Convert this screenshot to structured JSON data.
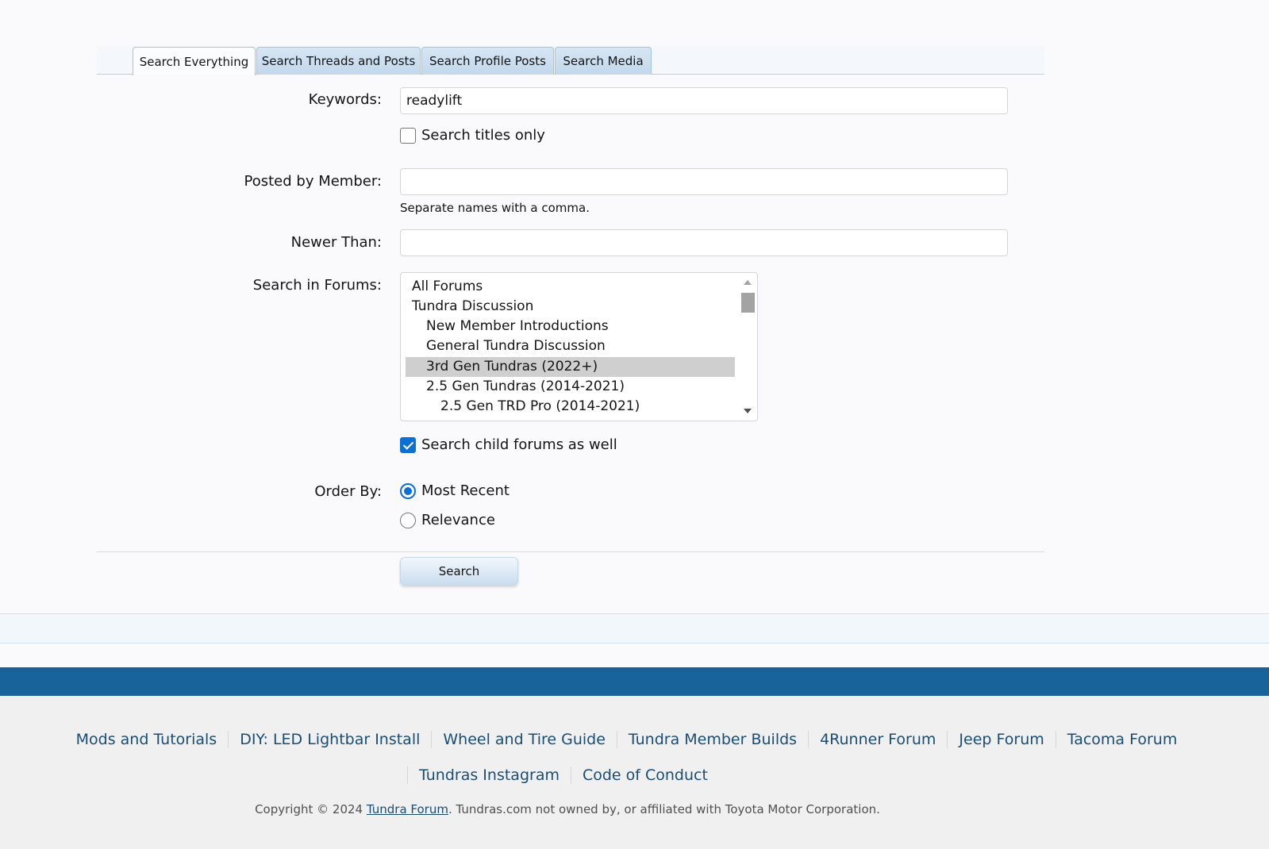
{
  "tabs": [
    {
      "label": "Search Everything",
      "active": true
    },
    {
      "label": "Search Threads and Posts",
      "active": false
    },
    {
      "label": "Search Profile Posts",
      "active": false
    },
    {
      "label": "Search Media",
      "active": false
    }
  ],
  "form": {
    "keywords": {
      "label": "Keywords:",
      "value": "readylift"
    },
    "titles_only": {
      "label": "Search titles only",
      "checked": false
    },
    "posted_by": {
      "label": "Posted by Member:",
      "value": "",
      "hint": "Separate names with a comma."
    },
    "newer_than": {
      "label": "Newer Than:",
      "value": ""
    },
    "forums": {
      "label": "Search in Forums:",
      "items": [
        {
          "label": "All Forums",
          "depth": 0,
          "selected": false
        },
        {
          "label": "Tundra Discussion",
          "depth": 0,
          "selected": false
        },
        {
          "label": "New Member Introductions",
          "depth": 1,
          "selected": false
        },
        {
          "label": "General Tundra Discussion",
          "depth": 1,
          "selected": false
        },
        {
          "label": "3rd Gen Tundras (2022+)",
          "depth": 1,
          "selected": true
        },
        {
          "label": "2.5 Gen Tundras (2014-2021)",
          "depth": 1,
          "selected": false
        },
        {
          "label": "2.5 Gen TRD Pro (2014-2021)",
          "depth": 2,
          "selected": false
        }
      ]
    },
    "child_forums": {
      "label": "Search child forums as well",
      "checked": true
    },
    "order_by": {
      "label": "Order By:",
      "options": [
        {
          "label": "Most Recent",
          "checked": true
        },
        {
          "label": "Relevance",
          "checked": false
        }
      ]
    },
    "submit_label": "Search"
  },
  "footer": {
    "links_row1": [
      "Mods and Tutorials",
      "DIY: LED Lightbar Install",
      "Wheel and Tire Guide",
      "Tundra Member Builds",
      "4Runner Forum",
      "Jeep Forum",
      "Tacoma Forum"
    ],
    "links_row2": [
      "Tundras Instagram",
      "Code of Conduct"
    ],
    "copyright_prefix": "Copyright © 2024 ",
    "copyright_link": "Tundra Forum",
    "copyright_suffix": ". Tundras.com not owned by, or affiliated with Toyota Motor Corporation."
  }
}
